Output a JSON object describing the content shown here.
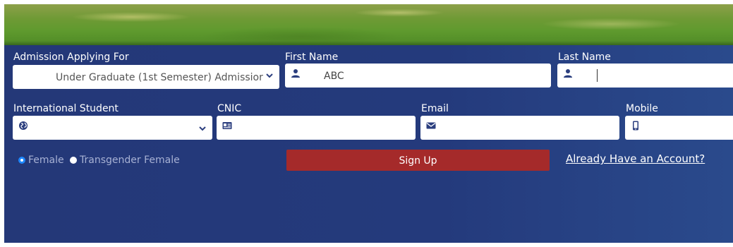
{
  "form": {
    "admission": {
      "label": "Admission Applying For",
      "value": "Under Graduate (1st Semester) Admissior"
    },
    "first_name": {
      "label": "First Name",
      "value": "ABC"
    },
    "last_name": {
      "label": "Last Name",
      "value": ""
    },
    "international": {
      "label": "International Student",
      "value": ""
    },
    "cnic": {
      "label": "CNIC",
      "value": ""
    },
    "email": {
      "label": "Email",
      "value": ""
    },
    "mobile": {
      "label": "Mobile",
      "value": ""
    },
    "gender": {
      "options": [
        {
          "label": "Female",
          "selected": true
        },
        {
          "label": "Transgender Female",
          "selected": false
        }
      ]
    },
    "signup_label": "Sign Up",
    "login_link": "Already Have an Account?"
  },
  "colors": {
    "panel": "#243878",
    "button": "#a52a2a",
    "radio_selected": "#1e88ff"
  }
}
